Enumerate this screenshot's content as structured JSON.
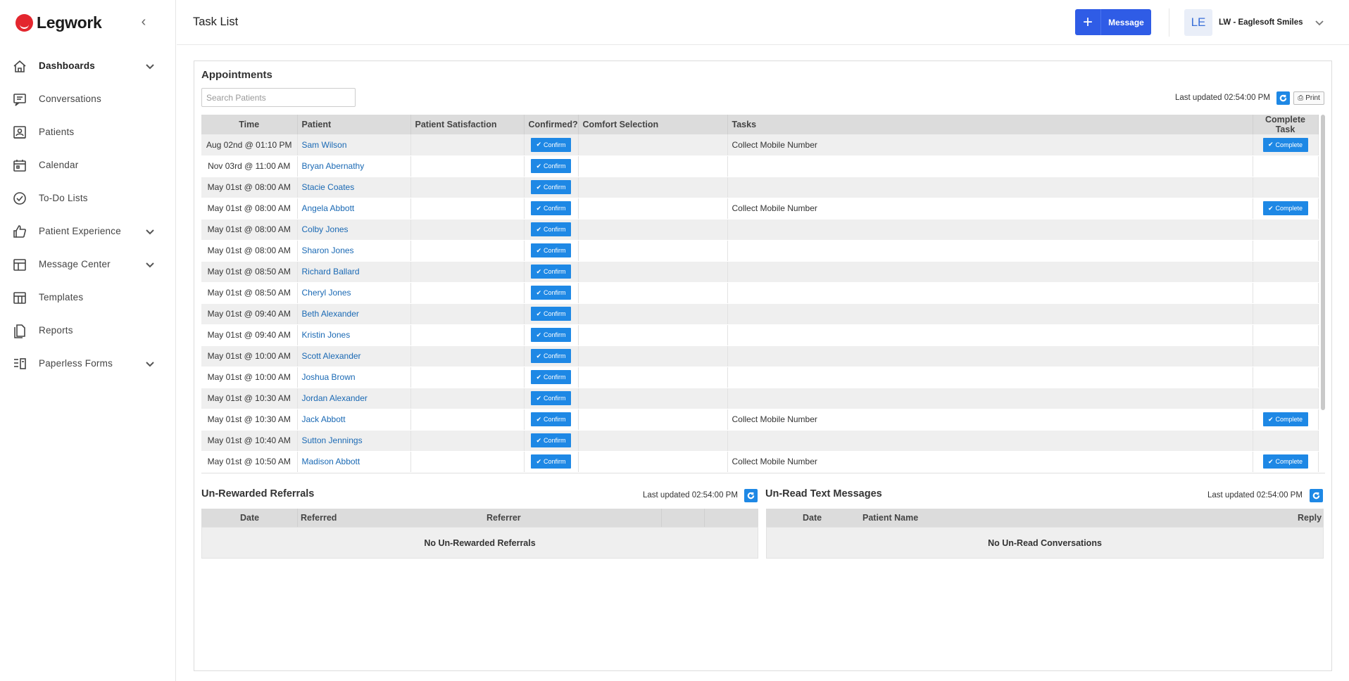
{
  "brand": {
    "name": "Legwork",
    "accent": "#e3262e"
  },
  "sidebar": {
    "collapse_icon": "chevron-left-icon",
    "items": [
      {
        "label": "Dashboards",
        "icon": "home-icon",
        "expandable": true,
        "active": true
      },
      {
        "label": "Conversations",
        "icon": "chat-icon",
        "expandable": false
      },
      {
        "label": "Patients",
        "icon": "patient-card-icon",
        "expandable": false
      },
      {
        "label": "Calendar",
        "icon": "calendar-icon",
        "expandable": false
      },
      {
        "label": "To-Do Lists",
        "icon": "check-circle-icon",
        "expandable": false
      },
      {
        "label": "Patient Experience",
        "icon": "thumbs-up-icon",
        "expandable": true
      },
      {
        "label": "Message Center",
        "icon": "message-center-icon",
        "expandable": true
      },
      {
        "label": "Templates",
        "icon": "templates-icon",
        "expandable": false
      },
      {
        "label": "Reports",
        "icon": "reports-icon",
        "expandable": false
      },
      {
        "label": "Paperless Forms",
        "icon": "forms-icon",
        "expandable": true
      }
    ]
  },
  "header": {
    "title": "Task List",
    "message_button": "Message",
    "avatar_initials": "LE",
    "account_name": "LW - Eaglesoft Smiles",
    "primary_color": "#2f5ce6"
  },
  "appointments": {
    "title": "Appointments",
    "search_placeholder": "Search Patients",
    "last_updated": "Last updated 02:54:00 PM",
    "print_label": "Print",
    "columns": [
      "Time",
      "Patient",
      "Patient Satisfaction",
      "Confirmed?",
      "Comfort Selection",
      "Tasks",
      "Complete Task"
    ],
    "confirm_label": "Confirm",
    "complete_label": "Complete",
    "rows": [
      {
        "time": "Aug 02nd @ 01:10 PM",
        "patient": "Sam Wilson",
        "task": "Collect Mobile Number"
      },
      {
        "time": "Nov 03rd @ 11:00 AM",
        "patient": "Bryan Abernathy",
        "task": ""
      },
      {
        "time": "May 01st @ 08:00 AM",
        "patient": "Stacie Coates",
        "task": ""
      },
      {
        "time": "May 01st @ 08:00 AM",
        "patient": "Angela Abbott",
        "task": "Collect Mobile Number"
      },
      {
        "time": "May 01st @ 08:00 AM",
        "patient": "Colby Jones",
        "task": ""
      },
      {
        "time": "May 01st @ 08:00 AM",
        "patient": "Sharon Jones",
        "task": ""
      },
      {
        "time": "May 01st @ 08:50 AM",
        "patient": "Richard Ballard",
        "task": ""
      },
      {
        "time": "May 01st @ 08:50 AM",
        "patient": "Cheryl Jones",
        "task": ""
      },
      {
        "time": "May 01st @ 09:40 AM",
        "patient": "Beth Alexander",
        "task": ""
      },
      {
        "time": "May 01st @ 09:40 AM",
        "patient": "Kristin Jones",
        "task": ""
      },
      {
        "time": "May 01st @ 10:00 AM",
        "patient": "Scott Alexander",
        "task": ""
      },
      {
        "time": "May 01st @ 10:00 AM",
        "patient": "Joshua Brown",
        "task": ""
      },
      {
        "time": "May 01st @ 10:30 AM",
        "patient": "Jordan Alexander",
        "task": ""
      },
      {
        "time": "May 01st @ 10:30 AM",
        "patient": "Jack Abbott",
        "task": "Collect Mobile Number"
      },
      {
        "time": "May 01st @ 10:40 AM",
        "patient": "Sutton Jennings",
        "task": ""
      },
      {
        "time": "May 01st @ 10:50 AM",
        "patient": "Madison Abbott",
        "task": "Collect Mobile Number"
      },
      {
        "time": "",
        "patient": "",
        "task": ""
      }
    ]
  },
  "referrals": {
    "title": "Un-Rewarded Referrals",
    "last_updated": "Last updated 02:54:00 PM",
    "columns": [
      "Date",
      "Referred",
      "Referrer"
    ],
    "empty": "No Un-Rewarded Referrals"
  },
  "unread": {
    "title": "Un-Read Text Messages",
    "last_updated": "Last updated 02:54:00 PM",
    "columns": [
      "Date",
      "Patient Name",
      "Reply"
    ],
    "empty": "No Un-Read Conversations"
  }
}
